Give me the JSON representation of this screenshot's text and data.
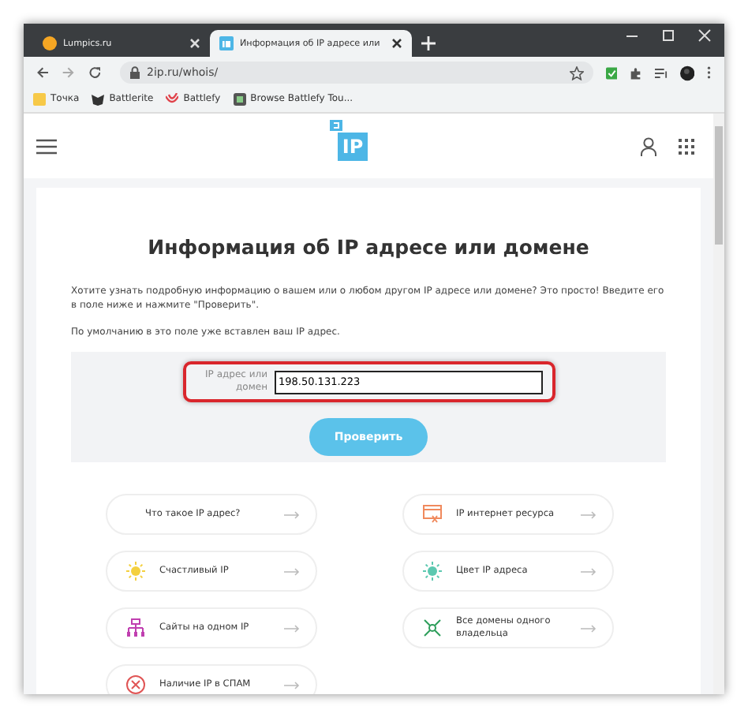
{
  "browser": {
    "tabs": [
      {
        "title": "Lumpics.ru",
        "selected": false
      },
      {
        "title": "Информация об IP адресе или",
        "selected": true
      }
    ],
    "address": "2ip.ru/whois/",
    "bookmarks": [
      {
        "label": "Точка"
      },
      {
        "label": "Battlerite"
      },
      {
        "label": "Battlefy"
      },
      {
        "label": "Browse Battlefy Tou..."
      }
    ]
  },
  "page": {
    "logo": "IP",
    "title": "Информация об IP адресе или домене",
    "intro": "Хотите узнать подробную информацию о вашем или о любом другом IP адресе или домене? Это просто! Введите его в поле ниже и нажмите \"Проверить\".",
    "note": "По умолчанию в это поле уже вставлен ваш IP адрес.",
    "field": {
      "label": "IP адрес или домен",
      "value": "198.50.131.223"
    },
    "button": "Проверить",
    "links": [
      {
        "label": "Что такое IP адрес?"
      },
      {
        "label": "IP интернет ресурса"
      },
      {
        "label": "Счастливый IP"
      },
      {
        "label": "Цвет IP адреса"
      },
      {
        "label": "Сайты на одном IP"
      },
      {
        "label": "Все домены одного владельца"
      },
      {
        "label": "Наличие IP в СПАМ"
      }
    ]
  }
}
